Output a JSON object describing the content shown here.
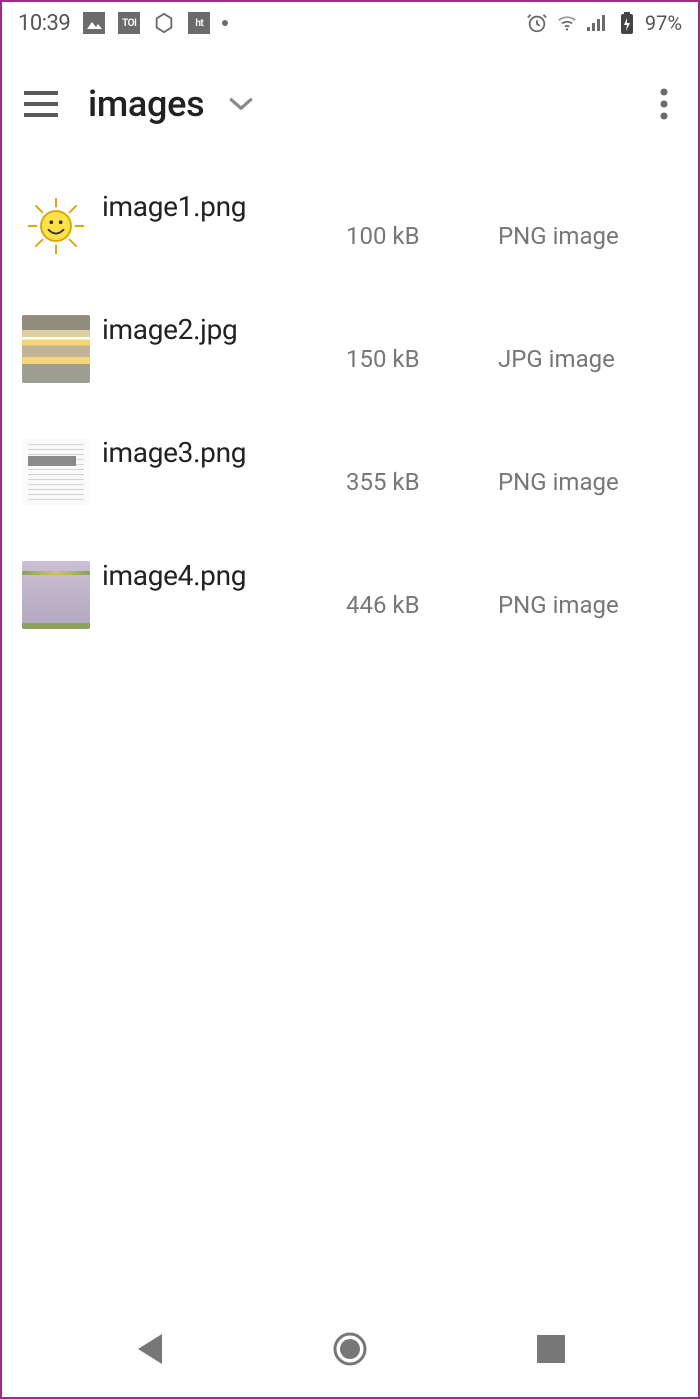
{
  "status": {
    "time": "10:39",
    "battery_pct": "97%"
  },
  "appbar": {
    "folder_title": "images"
  },
  "files": [
    {
      "name": "image1.png",
      "size": "100 kB",
      "type": "PNG image"
    },
    {
      "name": "image2.jpg",
      "size": "150 kB",
      "type": "JPG image"
    },
    {
      "name": "image3.png",
      "size": "355 kB",
      "type": "PNG image"
    },
    {
      "name": "image4.png",
      "size": "446 kB",
      "type": "PNG image"
    }
  ]
}
